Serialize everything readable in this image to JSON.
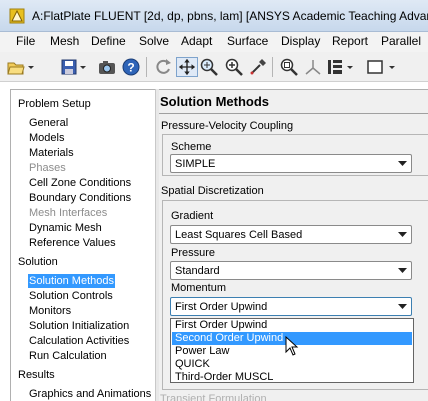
{
  "window": {
    "title": "A:FlatPlate FLUENT  [2d, dp, pbns, lam] [ANSYS Academic Teaching Advanc"
  },
  "menu": [
    "File",
    "Mesh",
    "Define",
    "Solve",
    "Adapt",
    "Surface",
    "Display",
    "Report",
    "Parallel"
  ],
  "toolbar": {
    "icons": [
      "open-folder-icon",
      "dropdown-arrow-icon",
      "save-icon",
      "dropdown-arrow-icon",
      "camera-icon",
      "help-icon",
      "rotate-icon",
      "translate-icon",
      "zoom-icon",
      "zoom-in-icon",
      "probe-icon",
      "zoom-to-fit-icon",
      "axes-icon",
      "layout-icon",
      "dropdown-arrow-icon",
      "window-icon",
      "dropdown-arrow-icon"
    ]
  },
  "nav": {
    "problem_setup": "Problem Setup",
    "items_setup": [
      {
        "label": "General",
        "disabled": false
      },
      {
        "label": "Models",
        "disabled": false
      },
      {
        "label": "Materials",
        "disabled": false
      },
      {
        "label": "Phases",
        "disabled": true
      },
      {
        "label": "Cell Zone Conditions",
        "disabled": false
      },
      {
        "label": "Boundary Conditions",
        "disabled": false
      },
      {
        "label": "Mesh Interfaces",
        "disabled": true
      },
      {
        "label": "Dynamic Mesh",
        "disabled": false
      },
      {
        "label": "Reference Values",
        "disabled": false
      }
    ],
    "solution": "Solution",
    "items_solution": [
      {
        "label": "Solution Methods",
        "selected": true
      },
      {
        "label": "Solution Controls"
      },
      {
        "label": "Monitors"
      },
      {
        "label": "Solution Initialization"
      },
      {
        "label": "Calculation Activities"
      },
      {
        "label": "Run Calculation"
      }
    ],
    "results": "Results",
    "items_results": [
      {
        "label": "Graphics and Animations"
      }
    ]
  },
  "panel": {
    "title": "Solution Methods",
    "pv_coupling": {
      "label": "Pressure-Velocity Coupling",
      "scheme_label": "Scheme",
      "scheme_value": "SIMPLE"
    },
    "spatial": {
      "label": "Spatial Discretization",
      "gradient_label": "Gradient",
      "gradient_value": "Least Squares Cell Based",
      "pressure_label": "Pressure",
      "pressure_value": "Standard",
      "momentum_label": "Momentum",
      "momentum_value": "First Order Upwind",
      "momentum_options": [
        "First Order Upwind",
        "Second Order Upwind",
        "Power Law",
        "QUICK",
        "Third-Order MUSCL"
      ],
      "highlighted_option": "Second Order Upwind"
    },
    "transient_label": "Transient Formulation"
  }
}
